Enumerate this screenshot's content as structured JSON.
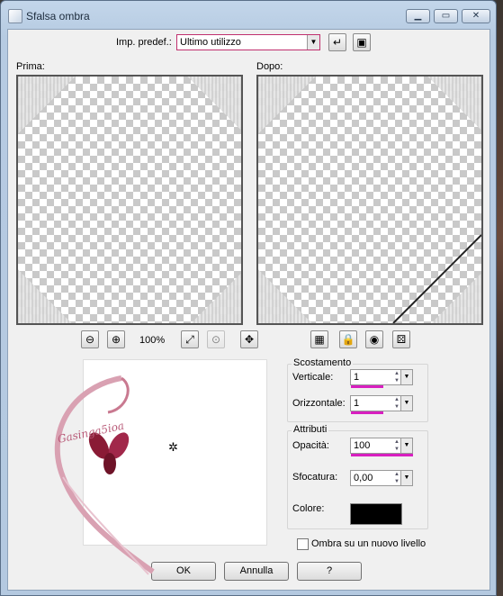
{
  "window": {
    "title": "Sfalsa ombra"
  },
  "preset": {
    "label": "Imp. predef.:",
    "value": "Ultimo utilizzo"
  },
  "before_label": "Prima:",
  "after_label": "Dopo:",
  "zoom": {
    "value": "100%"
  },
  "offset": {
    "group_label": "Scostamento",
    "vertical_label": "Verticale:",
    "vertical_value": "1",
    "horizontal_label": "Orizzontale:",
    "horizontal_value": "1"
  },
  "attributes": {
    "group_label": "Attributi",
    "opacity_label": "Opacità:",
    "opacity_value": "100",
    "blur_label": "Sfocatura:",
    "blur_value": "0,00",
    "color_label": "Colore:",
    "color_value": "#000000"
  },
  "new_layer_label": "Ombra su un nuovo livello",
  "buttons": {
    "ok": "OK",
    "cancel": "Annulla",
    "help": "?"
  },
  "watermark_text": "Gasinga5ioa",
  "accent_color": "#d81fc0"
}
